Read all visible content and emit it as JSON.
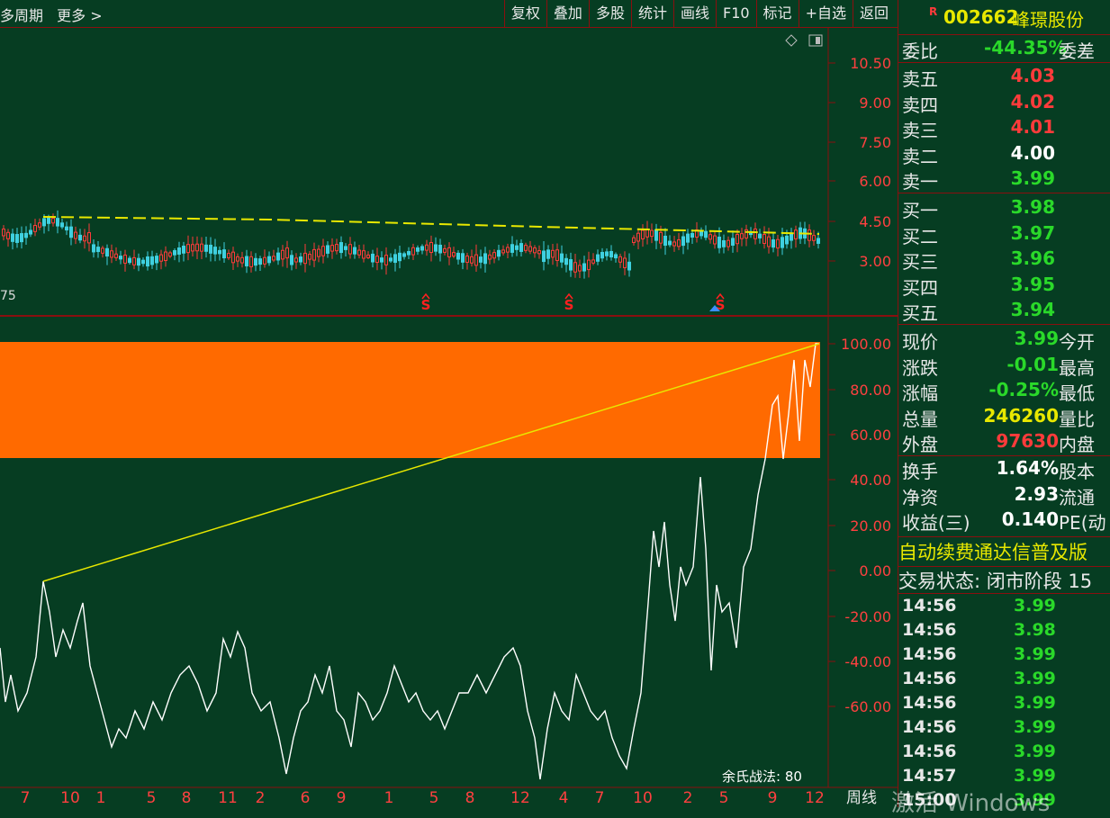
{
  "toolbar": {
    "left_items": [
      "多周期",
      "更多 >"
    ],
    "buttons": [
      "复权",
      "叠加",
      "多股",
      "统计",
      "画线",
      "F10",
      "标记",
      "+自选",
      "返回"
    ]
  },
  "main_chart": {
    "y_ticks": [
      "10.50",
      "9.00",
      "7.50",
      "6.00",
      "4.50",
      "3.00"
    ],
    "left_fragment": "75",
    "markers": [
      "S",
      "S",
      "S"
    ]
  },
  "sub_chart": {
    "y_ticks": [
      "100.00",
      "80.00",
      "60.00",
      "40.00",
      "20.00",
      "0.00",
      "-20.00",
      "-40.00",
      "-60.00"
    ],
    "indicator_label": "余氏战法: 80",
    "band_color": "#ff6a00"
  },
  "x_axis": {
    "labels": [
      "7",
      "10",
      "1",
      "5",
      "8",
      "11",
      "2",
      "6",
      "9",
      "1",
      "5",
      "8",
      "12",
      "4",
      "7",
      "10",
      "2",
      "5",
      "9",
      "12"
    ],
    "period_label": "周线"
  },
  "quote": {
    "r_tag": "R",
    "code": "002662",
    "name": "峰璟股份",
    "weibi_label": "委比",
    "weibi_value": "-44.35%",
    "weicha_label": "委差",
    "sell": [
      {
        "label": "卖五",
        "price": "4.03",
        "color": "red"
      },
      {
        "label": "卖四",
        "price": "4.02",
        "color": "red"
      },
      {
        "label": "卖三",
        "price": "4.01",
        "color": "red"
      },
      {
        "label": "卖二",
        "price": "4.00",
        "color": "white"
      },
      {
        "label": "卖一",
        "price": "3.99",
        "color": "green"
      }
    ],
    "buy": [
      {
        "label": "买一",
        "price": "3.98",
        "color": "green"
      },
      {
        "label": "买二",
        "price": "3.97",
        "color": "green"
      },
      {
        "label": "买三",
        "price": "3.96",
        "color": "green"
      },
      {
        "label": "买四",
        "price": "3.95",
        "color": "green"
      },
      {
        "label": "买五",
        "price": "3.94",
        "color": "green"
      }
    ],
    "stats1": [
      {
        "label": "现价",
        "value": "3.99",
        "tail": "今开",
        "color": "green"
      },
      {
        "label": "涨跌",
        "value": "-0.01",
        "tail": "最高",
        "color": "green"
      },
      {
        "label": "涨幅",
        "value": "-0.25%",
        "tail": "最低",
        "color": "green"
      },
      {
        "label": "总量",
        "value": "246260",
        "tail": "量比",
        "color": "yellow"
      },
      {
        "label": "外盘",
        "value": "97630",
        "tail": "内盘",
        "color": "red"
      }
    ],
    "stats2": [
      {
        "label": "换手",
        "value": "1.64%",
        "tail": "股本",
        "color": "white"
      },
      {
        "label": "净资",
        "value": "2.93",
        "tail": "流通",
        "color": "white"
      },
      {
        "label": "收益(三)",
        "value": "0.140",
        "tail": "PE(动",
        "color": "white"
      }
    ],
    "notice": "自动续费通达信普及版",
    "status": "交易状态: 闭市阶段 15",
    "trades": [
      {
        "time": "14:56",
        "price": "3.99"
      },
      {
        "time": "14:56",
        "price": "3.98"
      },
      {
        "time": "14:56",
        "price": "3.99"
      },
      {
        "time": "14:56",
        "price": "3.99"
      },
      {
        "time": "14:56",
        "price": "3.99"
      },
      {
        "time": "14:56",
        "price": "3.99"
      },
      {
        "time": "14:56",
        "price": "3.99"
      },
      {
        "time": "14:57",
        "price": "3.99"
      },
      {
        "time": "15:00",
        "price": "3.99"
      }
    ]
  },
  "watermark": "激活 Windows"
}
